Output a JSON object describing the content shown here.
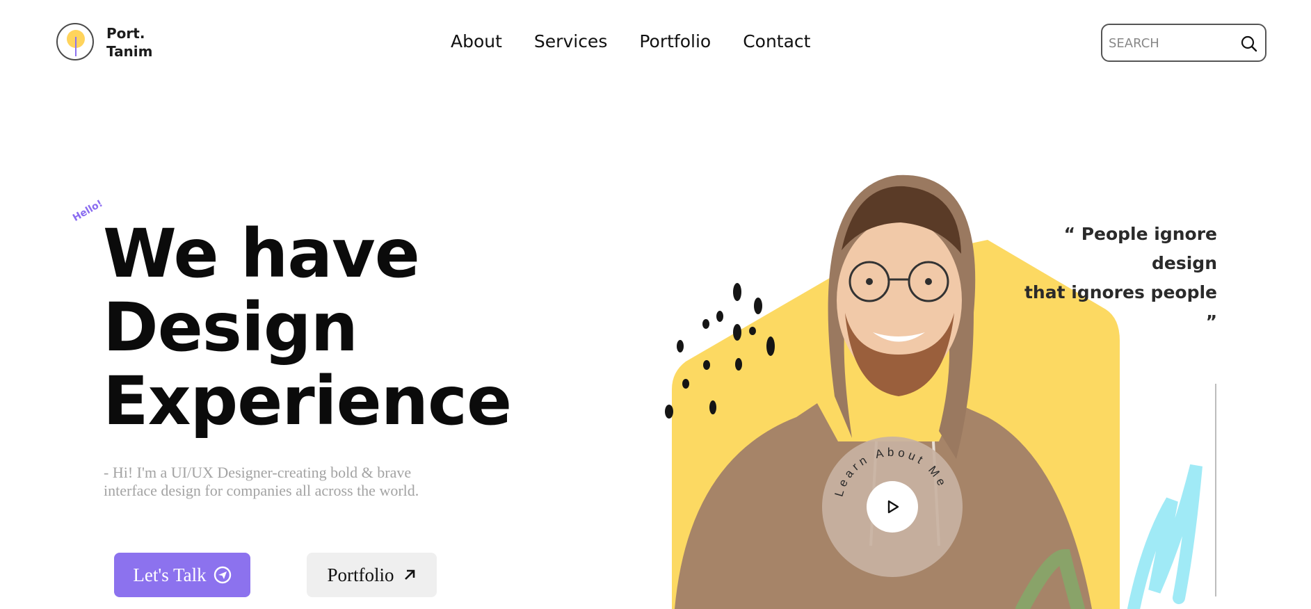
{
  "brand": {
    "line1": "Port.",
    "line2": "Tanim"
  },
  "nav": {
    "items": [
      "About",
      "Services",
      "Portfolio",
      "Contact"
    ]
  },
  "search": {
    "placeholder": "SEARCH",
    "icon": "search-icon"
  },
  "hero": {
    "badge": "Hello!",
    "headline_line1": "We have",
    "headline_line2": "Design",
    "headline_line3": "Experience",
    "intro": "- Hi! I'm a UI/UX Designer-creating bold & brave interface design for companies all across the world."
  },
  "buttons": {
    "talk_label": "Let's Talk",
    "talk_icon": "send-icon",
    "portfolio_label": "Portfolio",
    "portfolio_icon": "arrow-up-right-icon"
  },
  "quote": {
    "line1": "“ People ignore design",
    "line2": "that ignores people ”"
  },
  "learn_badge": {
    "text": "Learn About Me",
    "icon": "play-icon"
  },
  "colors": {
    "accent": "#8c72ee",
    "hexagon": "#fcd962",
    "secondary_button": "#efefef",
    "intro_text": "#a3a3a3"
  }
}
